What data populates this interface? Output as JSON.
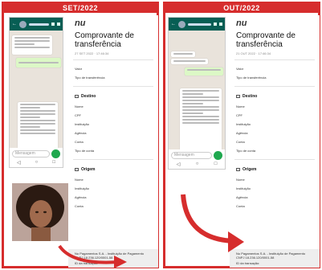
{
  "left": {
    "banner": "SET/2022",
    "input_placeholder": "Mensagem"
  },
  "right": {
    "banner": "OUT/2022",
    "input_placeholder": "Mensagem"
  },
  "receipt_left": {
    "logo": "nu",
    "title": "Comprovante de transferência",
    "date": "27 SET 2022 · 17:46:34",
    "valor_label": "Valor",
    "tipo_label": "Tipo de transferência",
    "destino": "Destino",
    "nome": "Nome",
    "cpf": "CPF",
    "instituicao": "Instituição",
    "agencia": "Agência",
    "conta": "Conta",
    "tipo_conta": "Tipo de conta",
    "origem": "Origem",
    "nome2": "Nome",
    "instituicao2": "Instituição",
    "agencia2": "Agência",
    "conta2": "Conta",
    "footer1": "Nu Pagamentos S.A. - Instituição de Pagamento",
    "footer2": "CNPJ 18.236.120/0001-58",
    "footer3": "ID da transação:"
  },
  "receipt_right": {
    "logo": "nu",
    "title": "Comprovante de transferência",
    "date": "21 OUT 2022 · 17:46:34",
    "valor_label": "Valor",
    "tipo_label": "Tipo de transferência",
    "destino": "Destino",
    "nome": "Nome",
    "cpf": "CPF",
    "instituicao": "Instituição",
    "agencia": "Agência",
    "conta": "Conta",
    "tipo_conta": "Tipo de conta",
    "origem": "Origem",
    "nome2": "Nome",
    "instituicao2": "Instituição",
    "agencia2": "Agência",
    "conta2": "Conta",
    "footer1": "Nu Pagamentos S.A. - Instituição de Pagamento",
    "footer2": "CNPJ 18.236.120/0001-58",
    "footer3": "ID da transação:"
  },
  "nav": {
    "back": "◁",
    "home": "○",
    "recent": "□"
  },
  "colors": {
    "accent": "#d62d2d",
    "wa": "#075e54"
  }
}
